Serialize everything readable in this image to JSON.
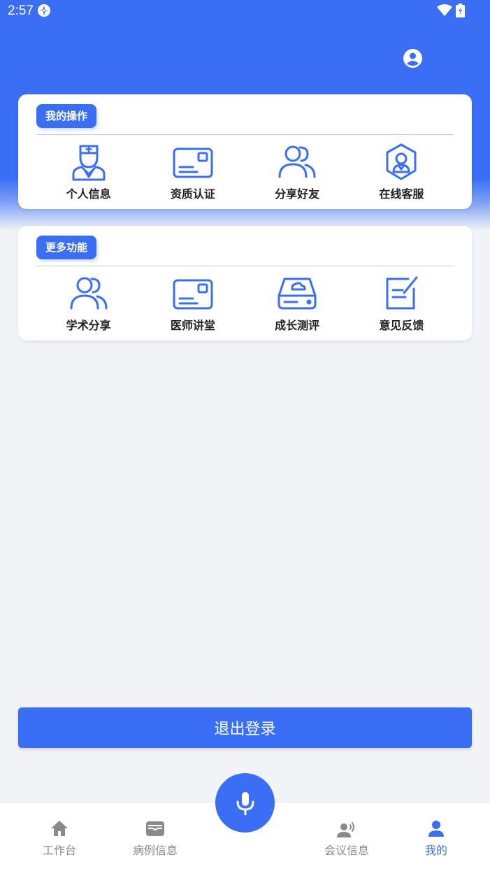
{
  "status_bar": {
    "time": "2:57"
  },
  "colors": {
    "primary": "#3a6ff5",
    "background": "#f2f3f6",
    "tab_inactive": "#8a8a8a"
  },
  "header": {
    "profile_icon": "account-circle-icon"
  },
  "my_operations": {
    "title": "我的操作",
    "items": [
      {
        "label": "个人信息",
        "icon": "nurse-icon"
      },
      {
        "label": "资质认证",
        "icon": "id-card-icon"
      },
      {
        "label": "分享好友",
        "icon": "users-icon"
      },
      {
        "label": "在线客服",
        "icon": "customer-service-icon"
      }
    ]
  },
  "more_features": {
    "title": "更多功能",
    "items": [
      {
        "label": "学术分享",
        "icon": "users-icon"
      },
      {
        "label": "医师讲堂",
        "icon": "id-card-icon"
      },
      {
        "label": "成长测评",
        "icon": "cloud-drive-icon"
      },
      {
        "label": "意见反馈",
        "icon": "edit-note-icon"
      }
    ]
  },
  "logout_label": "退出登录",
  "tabbar": {
    "items": [
      {
        "label": "工作台",
        "icon": "home-icon",
        "active": false
      },
      {
        "label": "病例信息",
        "icon": "wallet-icon",
        "active": false
      },
      {
        "label": "会议信息",
        "icon": "person-voice-icon",
        "active": false
      },
      {
        "label": "我的",
        "icon": "person-icon",
        "active": true
      }
    ],
    "center": "microphone-icon"
  }
}
